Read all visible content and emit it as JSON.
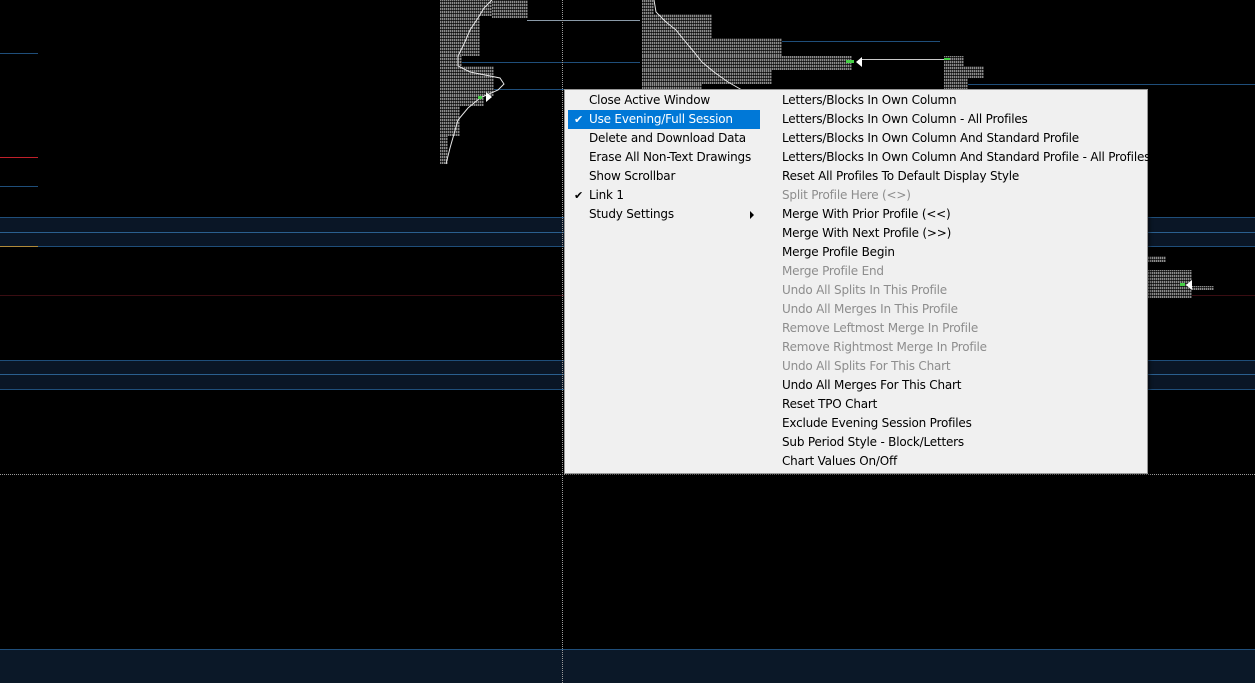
{
  "menu": {
    "left_items": [
      {
        "label": "Close Active Window",
        "checked": false,
        "selected": false,
        "submenu": false
      },
      {
        "label": "Use Evening/Full Session",
        "checked": true,
        "selected": true,
        "submenu": false
      },
      {
        "label": "Delete and Download Data",
        "checked": false,
        "selected": false,
        "submenu": false
      },
      {
        "label": "Erase All Non-Text Drawings",
        "checked": false,
        "selected": false,
        "submenu": false
      },
      {
        "label": "Show Scrollbar",
        "checked": false,
        "selected": false,
        "submenu": false
      },
      {
        "label": "Link 1",
        "checked": true,
        "selected": false,
        "submenu": false
      },
      {
        "label": "Study Settings",
        "checked": false,
        "selected": false,
        "submenu": true
      }
    ],
    "right_items": [
      {
        "label": "Letters/Blocks In Own Column",
        "enabled": true
      },
      {
        "label": "Letters/Blocks In Own Column - All Profiles",
        "enabled": true
      },
      {
        "label": "Letters/Blocks In Own Column And Standard Profile",
        "enabled": true
      },
      {
        "label": "Letters/Blocks In Own Column And Standard Profile - All Profiles",
        "enabled": true
      },
      {
        "label": "Reset All Profiles To Default Display Style",
        "enabled": true
      },
      {
        "label": "Split Profile Here (<>)",
        "enabled": false
      },
      {
        "label": "Merge With Prior Profile (<<)",
        "enabled": true
      },
      {
        "label": "Merge With Next Profile (>>)",
        "enabled": true
      },
      {
        "label": "Merge Profile Begin",
        "enabled": true
      },
      {
        "label": "Merge Profile End",
        "enabled": false
      },
      {
        "label": "Undo All Splits In This Profile",
        "enabled": false
      },
      {
        "label": "Undo All Merges In This Profile",
        "enabled": false
      },
      {
        "label": "Remove Leftmost Merge In Profile",
        "enabled": false
      },
      {
        "label": "Remove Rightmost Merge In Profile",
        "enabled": false
      },
      {
        "label": "Undo All Splits For This Chart",
        "enabled": false
      },
      {
        "label": "Undo All Merges For This Chart",
        "enabled": true
      },
      {
        "label": "Reset TPO Chart",
        "enabled": true
      },
      {
        "label": "Exclude Evening Session Profiles",
        "enabled": true
      },
      {
        "label": "Sub Period Style - Block/Letters",
        "enabled": true
      },
      {
        "label": "Chart Values On/Off",
        "enabled": true
      }
    ],
    "check_glyph": "✔",
    "submenu_icon": "chevron-right-icon"
  },
  "colors": {
    "background": "#000000",
    "menu_background": "#f0f0f0",
    "selection": "#0078d7",
    "disabled_text": "#8d8d8d",
    "tpo_blocks": "#8a8a8a",
    "level_line_blue": "#1f4e7a",
    "level_line_red": "#c0202a"
  }
}
